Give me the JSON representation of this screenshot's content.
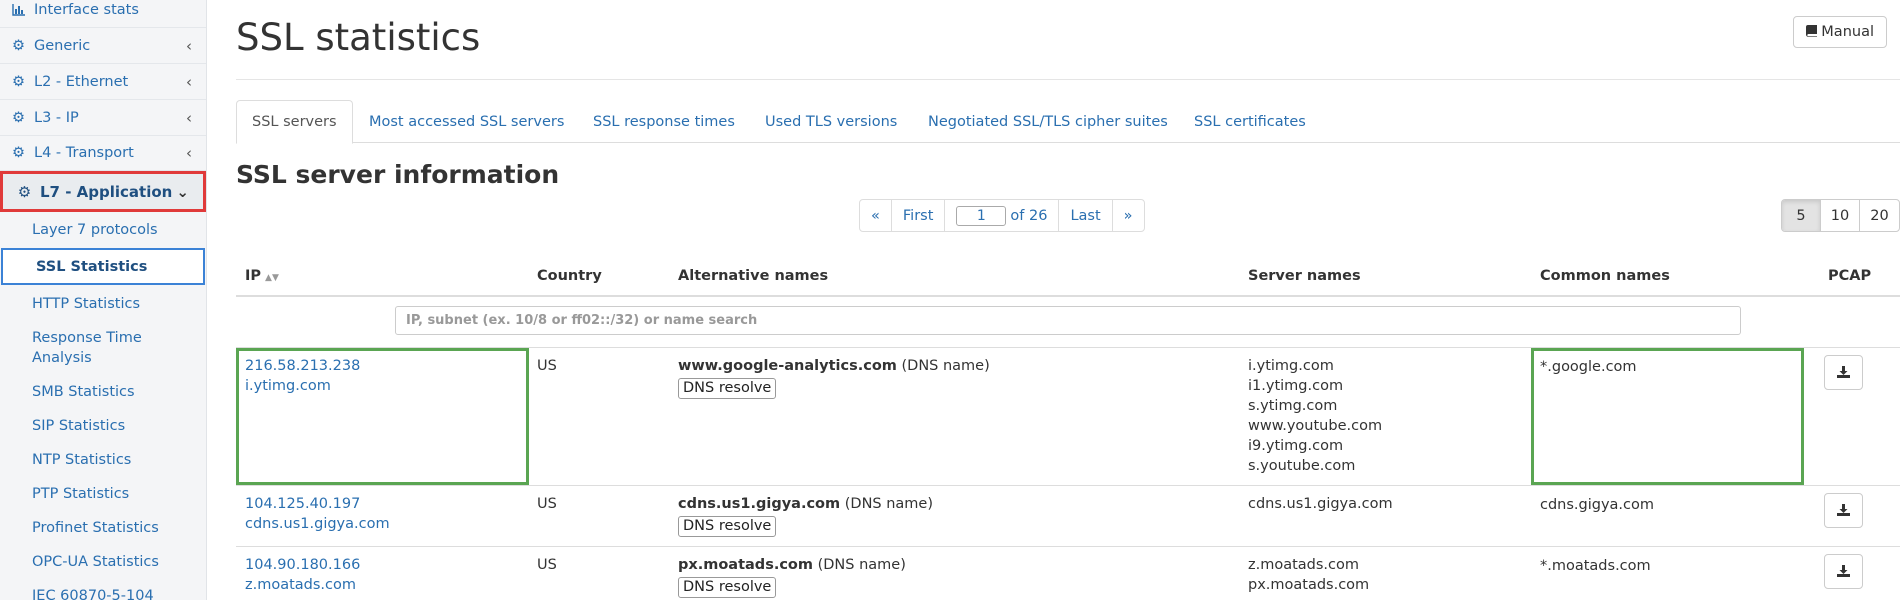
{
  "sidebar": {
    "items": [
      {
        "label": "Interface stats",
        "icon": "bar-chart-icon"
      },
      {
        "label": "Generic",
        "icon": "gear-icon"
      },
      {
        "label": "L2 - Ethernet",
        "icon": "gear-icon"
      },
      {
        "label": "L3 - IP",
        "icon": "gear-icon"
      },
      {
        "label": "L4 - Transport",
        "icon": "gear-icon"
      },
      {
        "label": "L7 - Application",
        "icon": "gear-icon"
      }
    ],
    "subitems": [
      "Layer 7 protocols",
      "SSL Statistics",
      "HTTP Statistics",
      "Response Time Analysis",
      "SMB Statistics",
      "SIP Statistics",
      "NTP Statistics",
      "PTP Statistics",
      "Profinet Statistics",
      "OPC-UA Statistics",
      "IEC 60870-5-104"
    ]
  },
  "header": {
    "title": "SSL statistics",
    "manual_label": "Manual"
  },
  "tabs": [
    "SSL servers",
    "Most accessed SSL servers",
    "SSL response times",
    "Used TLS versions",
    "Negotiated SSL/TLS cipher suites",
    "SSL certificates"
  ],
  "section_title": "SSL server information",
  "pager": {
    "prev": "«",
    "first": "First",
    "current": "1",
    "of_label": "of 26",
    "last": "Last",
    "next": "»"
  },
  "per_page": [
    "5",
    "10",
    "20"
  ],
  "table": {
    "columns": [
      "IP",
      "Country",
      "Alternative names",
      "Server names",
      "Common names",
      "PCAP"
    ],
    "search_placeholder": "IP, subnet (ex. 10/8 or ff02::/32) or name search",
    "dns_resolve_label": "DNS resolve",
    "dns_suffix": "(DNS name)",
    "rows": [
      {
        "ip": "216.58.213.238",
        "host": "i.ytimg.com",
        "country": "US",
        "alt_name": "www.google-analytics.com",
        "server_names": [
          "i.ytimg.com",
          "i1.ytimg.com",
          "s.ytimg.com",
          "www.youtube.com",
          "i9.ytimg.com",
          "s.youtube.com"
        ],
        "common_name": "*.google.com"
      },
      {
        "ip": "104.125.40.197",
        "host": "cdns.us1.gigya.com",
        "country": "US",
        "alt_name": "cdns.us1.gigya.com",
        "server_names": [
          "cdns.us1.gigya.com"
        ],
        "common_name": "cdns.gigya.com"
      },
      {
        "ip": "104.90.180.166",
        "host": "z.moatads.com",
        "country": "US",
        "alt_name": "px.moatads.com",
        "server_names": [
          "z.moatads.com",
          "px.moatads.com"
        ],
        "common_name": "*.moatads.com"
      }
    ]
  }
}
